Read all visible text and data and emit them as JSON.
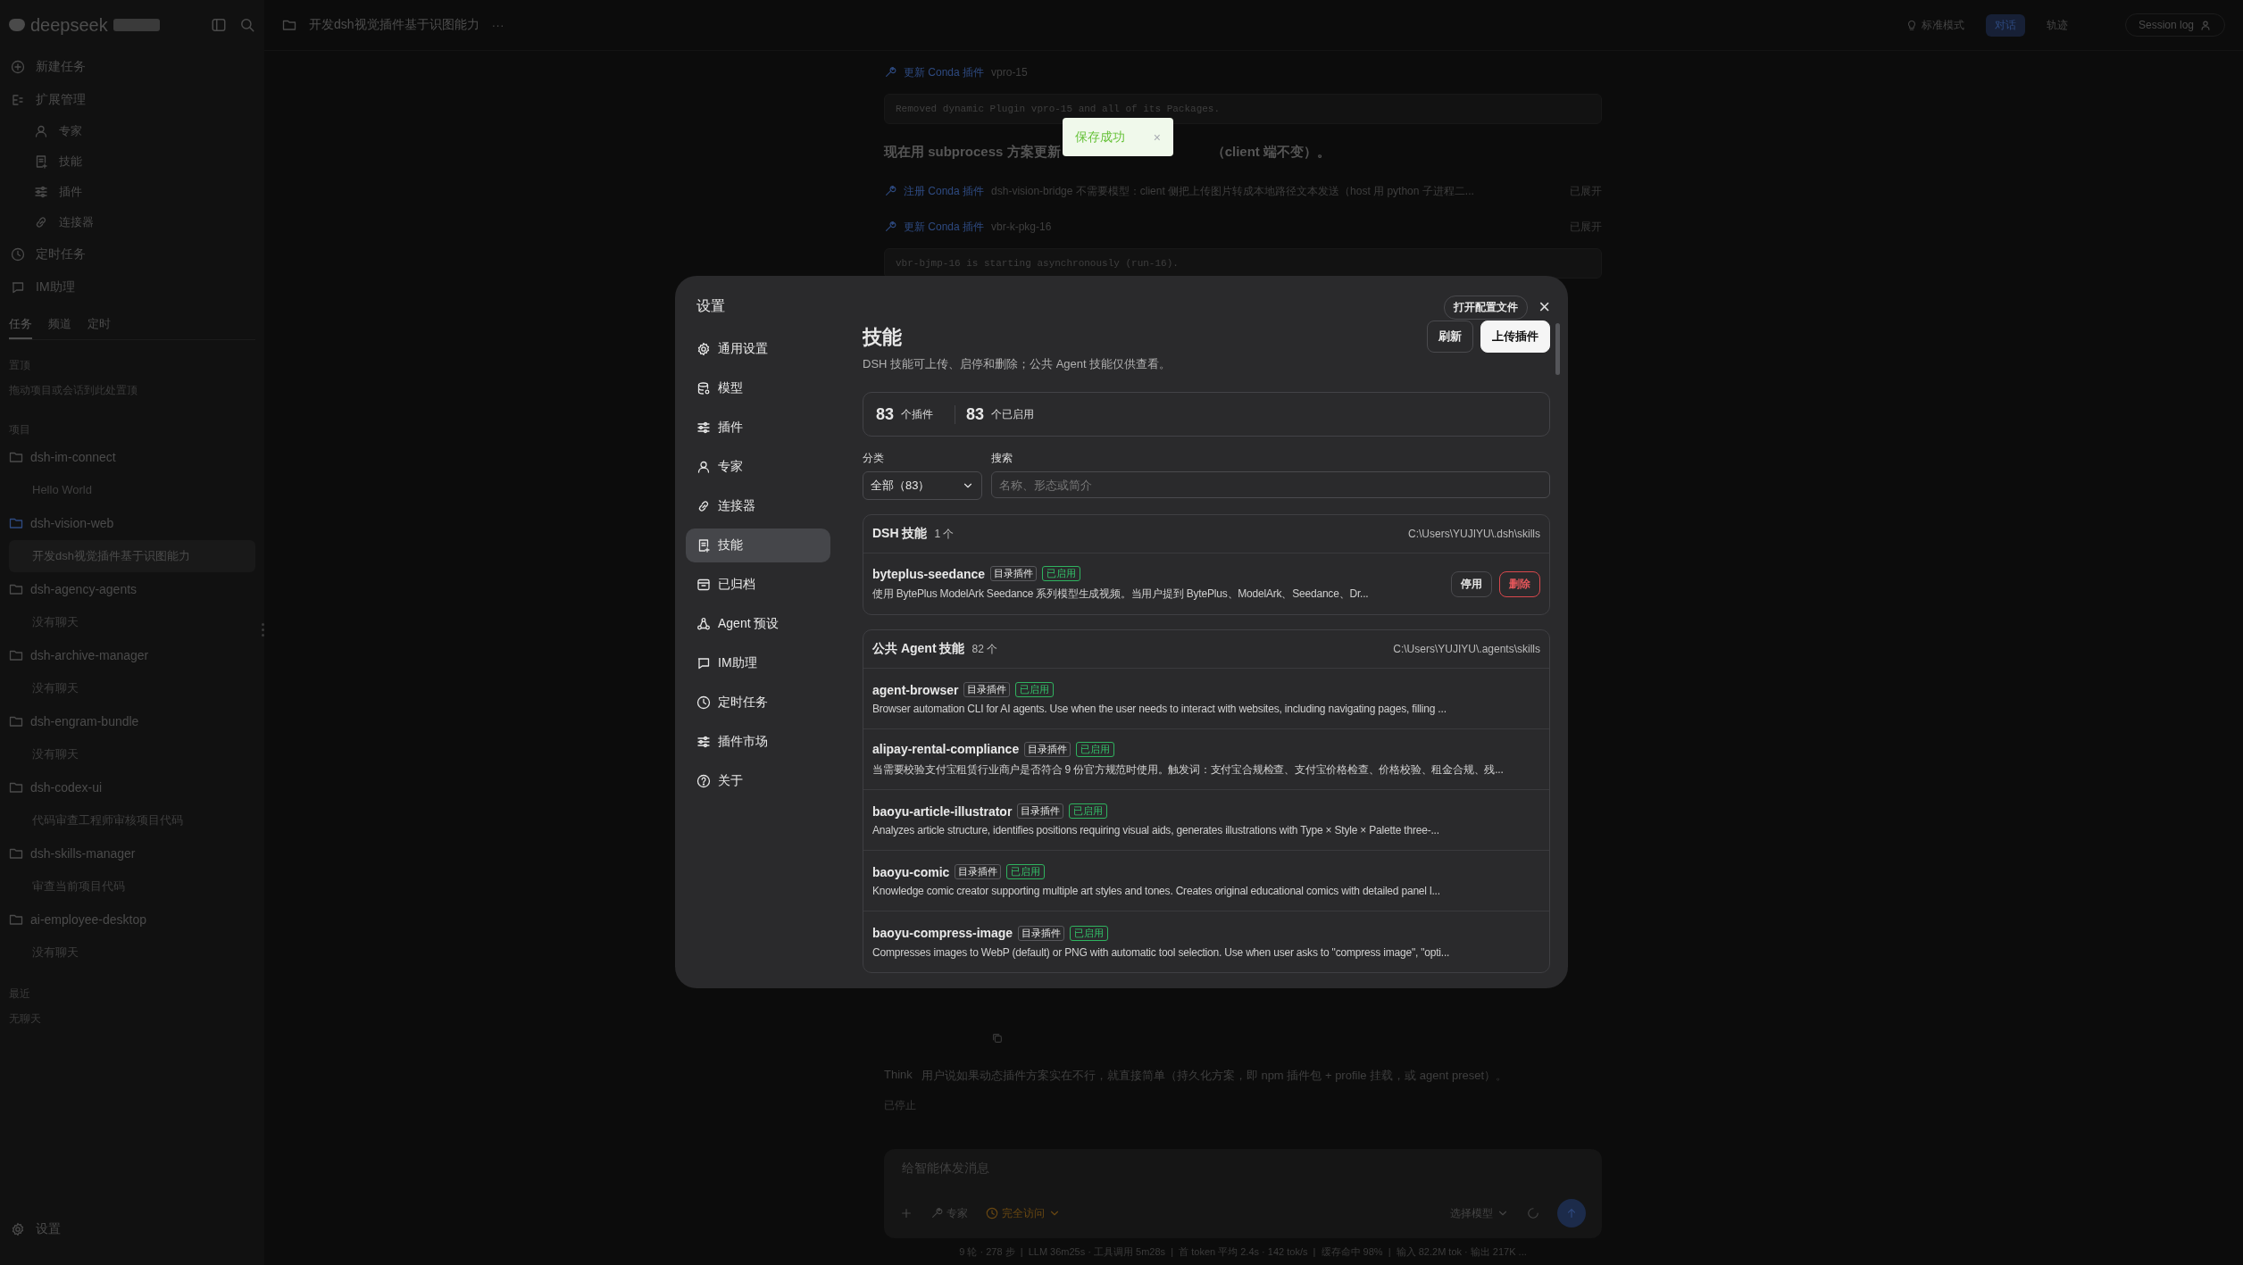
{
  "sidebar": {
    "brand": "deepseek",
    "nav": [
      {
        "label": "新建任务"
      },
      {
        "label": "扩展管理",
        "children": [
          {
            "label": "专家"
          },
          {
            "label": "技能"
          },
          {
            "label": "插件"
          },
          {
            "label": "连接器"
          }
        ]
      },
      {
        "label": "定时任务"
      },
      {
        "label": "IM助理"
      }
    ],
    "tabs": [
      {
        "label": "任务",
        "selected": true
      },
      {
        "label": "频道",
        "selected": false
      },
      {
        "label": "定时",
        "selected": false
      }
    ],
    "pinned": {
      "title": "置顶",
      "hint": "拖动项目或会话到此处置顶"
    },
    "projects_title": "项目",
    "projects": [
      {
        "name": "dsh-im-connect",
        "active": false,
        "chats": [
          {
            "title": "Hello World",
            "selected": false
          }
        ]
      },
      {
        "name": "dsh-vision-web",
        "active": true,
        "chats": [
          {
            "title": "开发dsh视觉插件基于识图能力",
            "selected": true
          }
        ]
      },
      {
        "name": "dsh-agency-agents",
        "active": false,
        "chats": [
          {
            "title": "没有聊天",
            "selected": false
          }
        ]
      },
      {
        "name": "dsh-archive-manager",
        "active": false,
        "chats": [
          {
            "title": "没有聊天",
            "selected": false
          }
        ]
      },
      {
        "name": "dsh-engram-bundle",
        "active": false,
        "chats": [
          {
            "title": "没有聊天",
            "selected": false
          }
        ]
      },
      {
        "name": "dsh-codex-ui",
        "active": false,
        "chats": [
          {
            "title": "代码审查工程师审核项目代码",
            "selected": false
          }
        ]
      },
      {
        "name": "dsh-skills-manager",
        "active": false,
        "chats": [
          {
            "title": "审查当前项目代码",
            "selected": false
          }
        ]
      },
      {
        "name": "ai-employee-desktop",
        "active": false,
        "chats": [
          {
            "title": "没有聊天",
            "selected": false
          }
        ]
      }
    ],
    "recent": {
      "title": "最近",
      "empty": "无聊天"
    },
    "settings": "设置"
  },
  "topbar": {
    "title": "开发dsh视觉插件基于识图能力",
    "more": "···",
    "modes": [
      {
        "label": "标准模式",
        "selected": false
      },
      {
        "label": "对话",
        "selected": true
      },
      {
        "label": "轨迹",
        "selected": false
      }
    ],
    "session_log": "Session log"
  },
  "conversation": [
    {
      "kind": "tool",
      "link": "更新 Conda 插件",
      "text": "vpro-15"
    },
    {
      "kind": "code",
      "text": "Removed dynamic Plugin vpro-15 and all of its Packages."
    },
    {
      "kind": "heading",
      "parts": [
        "现在用 subprocess 方案更新",
        "（client 端不变）。"
      ]
    },
    {
      "kind": "tool",
      "link": "注册 Conda 插件",
      "text": "dsh-vision-bridge  不需要模型：client 侧把上传图片转成本地路径文本发送（host 用 python 子进程二...",
      "right": "已展开"
    },
    {
      "kind": "tool",
      "link": "更新 Conda 插件",
      "text": "vbr-k-pkg-16",
      "right": "已展开"
    },
    {
      "kind": "code",
      "text": "vbr-bjmp-16 is starting asynchronously (run-16)."
    }
  ],
  "conversation_tail": [
    {
      "kind": "copy"
    },
    {
      "kind": "think",
      "label": "Think",
      "text": "用户说如果动态插件方案实在不行，就直接简单（持久化方案，即 npm 插件包 + profile 挂载，或 agent preset）。"
    },
    {
      "kind": "stopped",
      "text": "已停止"
    }
  ],
  "composer": {
    "placeholder": "给智能体发消息",
    "expert": "专家",
    "access": "完全访问",
    "model": "选择模型"
  },
  "status_bar": "9 轮 · 278 步  |  LLM 36m25s · 工具调用 5m28s  |  首 token 平均 2.4s · 142 tok/s  |  缓存命中 98%  |  输入 82.2M tok · 输出 217K ...",
  "toast": {
    "text": "保存成功",
    "close": "×"
  },
  "dialog": {
    "title": "设置",
    "open_config": "打开配置文件",
    "close": "×",
    "nav": [
      {
        "label": "通用设置",
        "selected": false
      },
      {
        "label": "模型",
        "selected": false
      },
      {
        "label": "插件",
        "selected": false
      },
      {
        "label": "专家",
        "selected": false
      },
      {
        "label": "连接器",
        "selected": false
      },
      {
        "label": "技能",
        "selected": true
      },
      {
        "label": "已归档",
        "selected": false
      },
      {
        "label": "Agent 预设",
        "selected": false
      },
      {
        "label": "IM助理",
        "selected": false
      },
      {
        "label": "定时任务",
        "selected": false
      },
      {
        "label": "插件市场",
        "selected": false
      },
      {
        "label": "关于",
        "selected": false
      }
    ],
    "page": {
      "title": "技能",
      "subtitle": "DSH 技能可上传、启停和删除；公共 Agent 技能仅供查看。",
      "actions": [
        {
          "label": "刷新",
          "primary": false
        },
        {
          "label": "上传插件",
          "primary": true
        }
      ]
    },
    "stats": [
      {
        "value": "83",
        "label": "个插件"
      },
      {
        "value": "83",
        "label": "个已启用"
      }
    ],
    "filters": {
      "category": {
        "label": "分类",
        "value": "全部（83）"
      },
      "search": {
        "label": "搜索",
        "placeholder": "名称、形态或简介"
      }
    },
    "sections": [
      {
        "title": "DSH 技能",
        "count": "1 个",
        "path": "C:\\Users\\YUJIYU\\.dsh\\skills",
        "skills": [
          {
            "name": "byteplus-seedance",
            "tag": "目录插件",
            "status": "已启用",
            "enabled": true,
            "description": "使用 BytePlus ModelArk Seedance 系列模型生成视频。当用户提到 BytePlus、ModelArk、Seedance、Dr...",
            "actions": [
              {
                "label": "停用",
                "kind": "default"
              },
              {
                "label": "删除",
                "kind": "danger"
              }
            ]
          }
        ]
      },
      {
        "title": "公共 Agent 技能",
        "count": "82 个",
        "path": "C:\\Users\\YUJIYU\\.agents\\skills",
        "skills": [
          {
            "name": "agent-browser",
            "tag": "目录插件",
            "status": "已启用",
            "enabled": true,
            "description": "Browser automation CLI for AI agents. Use when the user needs to interact with websites, including navigating pages, filling ..."
          },
          {
            "name": "alipay-rental-compliance",
            "tag": "目录插件",
            "status": "已启用",
            "enabled": true,
            "description": "当需要校验支付宝租赁行业商户是否符合 9 份官方规范时使用。触发词：支付宝合规检查、支付宝价格检查、价格校验、租金合规、残..."
          },
          {
            "name": "baoyu-article-illustrator",
            "tag": "目录插件",
            "status": "已启用",
            "enabled": true,
            "description": "Analyzes article structure, identifies positions requiring visual aids, generates illustrations with Type × Style × Palette three-..."
          },
          {
            "name": "baoyu-comic",
            "tag": "目录插件",
            "status": "已启用",
            "enabled": true,
            "description": "Knowledge comic creator supporting multiple art styles and tones. Creates original educational comics with detailed panel l..."
          },
          {
            "name": "baoyu-compress-image",
            "tag": "目录插件",
            "status": "已启用",
            "enabled": true,
            "description": "Compresses images to WebP (default) or PNG with automatic tool selection. Use when user asks to \"compress image\", \"opti..."
          }
        ]
      }
    ]
  }
}
